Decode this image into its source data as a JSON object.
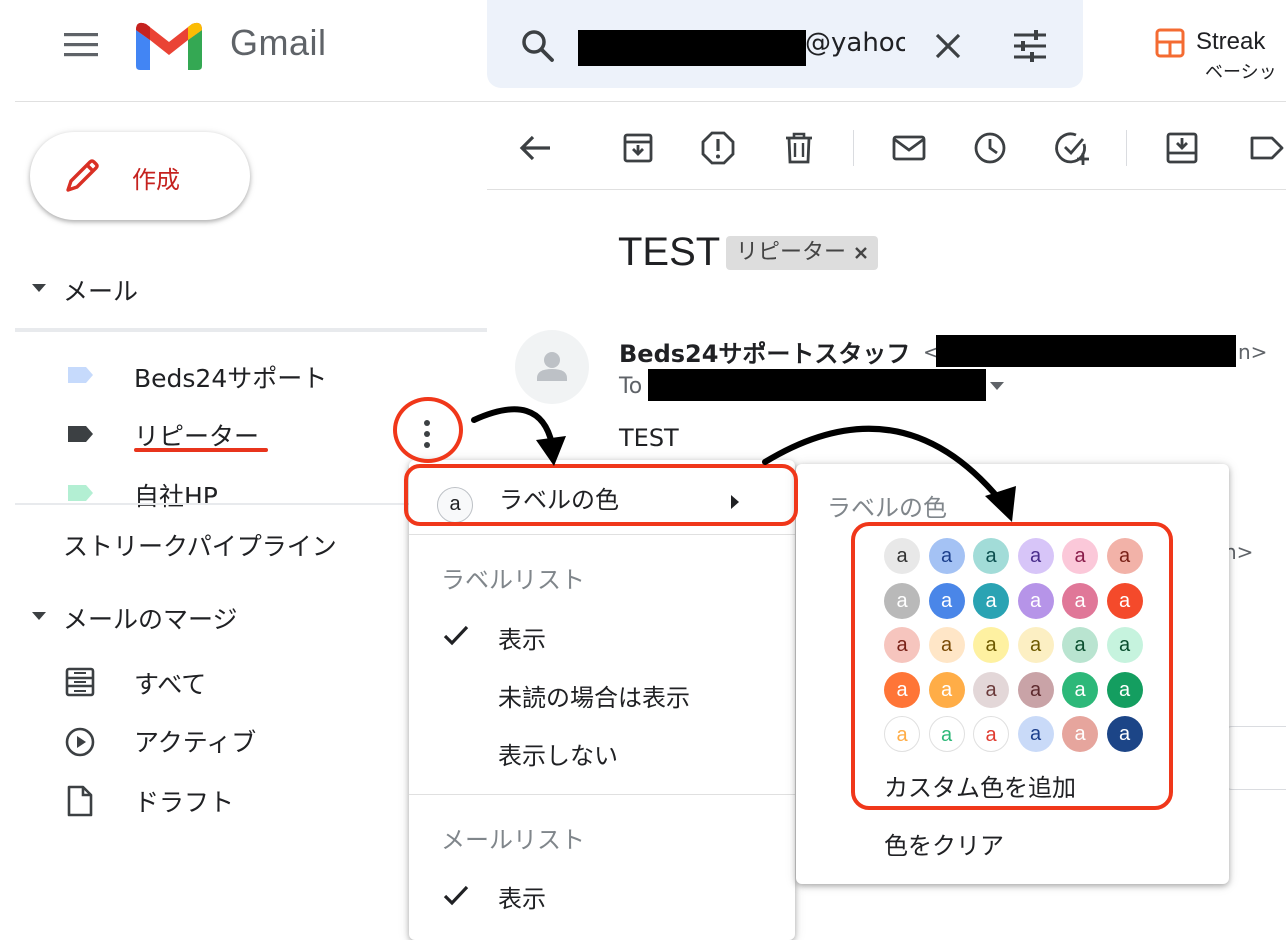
{
  "header": {
    "brand": "Gmail",
    "search_value": "@yahoo",
    "streak_title": "Streak",
    "streak_sub": "ベーシッ"
  },
  "compose": {
    "label": "作成"
  },
  "sidebar": {
    "mail_section": "メール",
    "labels": [
      {
        "name": "Beds24サポート",
        "color": "#c6dafc"
      },
      {
        "name": "リピーター",
        "color": "#3c4043"
      },
      {
        "name": "自社HP",
        "color": "#b3efd3"
      }
    ],
    "streak_pipeline": "ストリークパイプライン",
    "mail_merge_section": "メールのマージ",
    "merge_items": [
      {
        "name": "すべて",
        "icon": "inbox-stack-icon"
      },
      {
        "name": "アクティブ",
        "icon": "play-circle-icon"
      },
      {
        "name": "ドラフト",
        "icon": "document-icon"
      }
    ]
  },
  "email": {
    "subject": "TEST",
    "label_chip": "リピーター",
    "sender_name": "Beds24サポートスタッフ",
    "sender_open": "<",
    "sender_close": "n>",
    "to_label": "To",
    "body": "TEST",
    "peek_close": "n>"
  },
  "label_menu": {
    "label_color_item": "ラベルの色",
    "label_color_badge": "a",
    "label_list_heading": "ラベルリスト",
    "label_list_options": [
      "表示",
      "未読の場合は表示",
      "表示しない"
    ],
    "mail_list_heading": "メールリスト",
    "mail_list_options": [
      "表示"
    ]
  },
  "color_menu": {
    "heading": "ラベルの色",
    "swatch_letter": "a",
    "swatches": [
      [
        [
          "#e8e8e8",
          "#333333"
        ],
        [
          "#a4c2f4",
          "#1c3f8c"
        ],
        [
          "#a2dcd8",
          "#0b4f4f"
        ],
        [
          "#d7c5f8",
          "#4a2e8c"
        ],
        [
          "#fbc8d9",
          "#8a1c4a"
        ],
        [
          "#f2b2a8",
          "#7a2218"
        ]
      ],
      [
        [
          "#b9b9b9",
          "#ffffff"
        ],
        [
          "#4a86e8",
          "#ffffff"
        ],
        [
          "#2aa3b3",
          "#ffffff"
        ],
        [
          "#b694e8",
          "#ffffff"
        ],
        [
          "#e07798",
          "#ffffff"
        ],
        [
          "#f44a2b",
          "#ffffff"
        ]
      ],
      [
        [
          "#f6c5be",
          "#7a2218"
        ],
        [
          "#ffe6c7",
          "#7a4a06"
        ],
        [
          "#fef1a1",
          "#6e5a00"
        ],
        [
          "#fcefc3",
          "#6e5a00"
        ],
        [
          "#b9e4d0",
          "#0b4f2f"
        ],
        [
          "#c6f3de",
          "#0b4f2f"
        ]
      ],
      [
        [
          "#ff7537",
          "#ffffff"
        ],
        [
          "#ffad47",
          "#ffffff"
        ],
        [
          "#e3d7d8",
          "#6b3a3a"
        ],
        [
          "#c9a3a7",
          "#5e2a2e"
        ],
        [
          "#2db879",
          "#ffffff"
        ],
        [
          "#149e60",
          "#ffffff"
        ]
      ],
      [
        [
          "#ffffff",
          "#ffad47"
        ],
        [
          "#ffffff",
          "#2db879"
        ],
        [
          "#ffffff",
          "#e03c31"
        ],
        [
          "#c9daf8",
          "#1c3f8c"
        ],
        [
          "#e6a59d",
          "#ffffff"
        ],
        [
          "#1c4587",
          "#ffffff"
        ]
      ]
    ],
    "add_custom": "カスタム色を追加",
    "clear": "色をクリア"
  }
}
